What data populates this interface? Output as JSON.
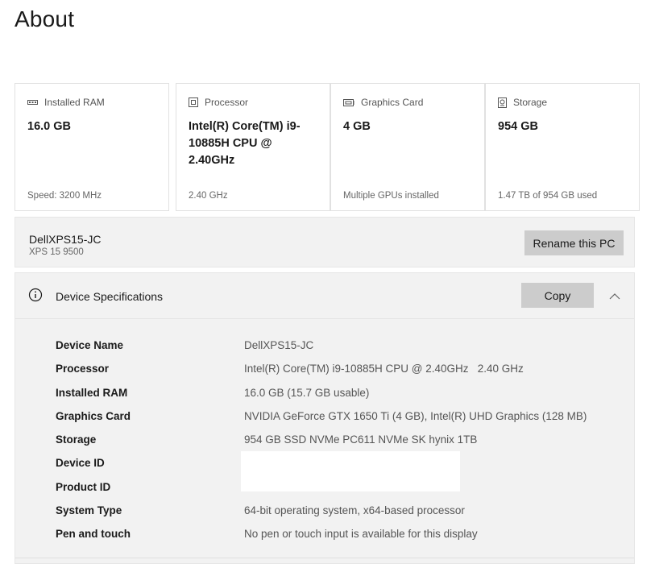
{
  "page": {
    "title": "About"
  },
  "cards": [
    {
      "icon": "ram-icon",
      "label": "Installed RAM",
      "value": "16.0 GB",
      "foot": "Speed: 3200 MHz"
    },
    {
      "icon": "processor-icon",
      "label": "Processor",
      "value": "Intel(R) Core(TM) i9-10885H CPU @ 2.40GHz",
      "foot": "2.40 GHz"
    },
    {
      "icon": "graphics-card-icon",
      "label": "Graphics Card",
      "value": "4 GB",
      "foot": "Multiple GPUs installed"
    },
    {
      "icon": "storage-icon",
      "label": "Storage",
      "value": "954 GB",
      "foot": "1.47 TB of 954 GB used"
    }
  ],
  "pc": {
    "name": "DellXPS15-JC",
    "model": "XPS 15 9500",
    "rename_label": "Rename this PC"
  },
  "specs": {
    "title": "Device Specifications",
    "copy_label": "Copy",
    "rows": [
      {
        "label": "Device Name",
        "value": "DellXPS15-JC"
      },
      {
        "label": "Processor",
        "value": "Intel(R) Core(TM) i9-10885H CPU @ 2.40GHz   2.40 GHz"
      },
      {
        "label": "Installed RAM",
        "value": "16.0 GB (15.7 GB usable)"
      },
      {
        "label": "Graphics Card",
        "value": "NVIDIA GeForce GTX 1650 Ti (4 GB), Intel(R) UHD Graphics (128 MB)"
      },
      {
        "label": "Storage",
        "value": "954 GB SSD NVMe PC611 NVMe SK hynix 1TB"
      },
      {
        "label": "Device ID",
        "value": ""
      },
      {
        "label": "Product ID",
        "value": ""
      },
      {
        "label": "System Type",
        "value": "64-bit operating system, x64-based processor"
      },
      {
        "label": "Pen and touch",
        "value": "No pen or touch input is available for this display"
      }
    ]
  }
}
